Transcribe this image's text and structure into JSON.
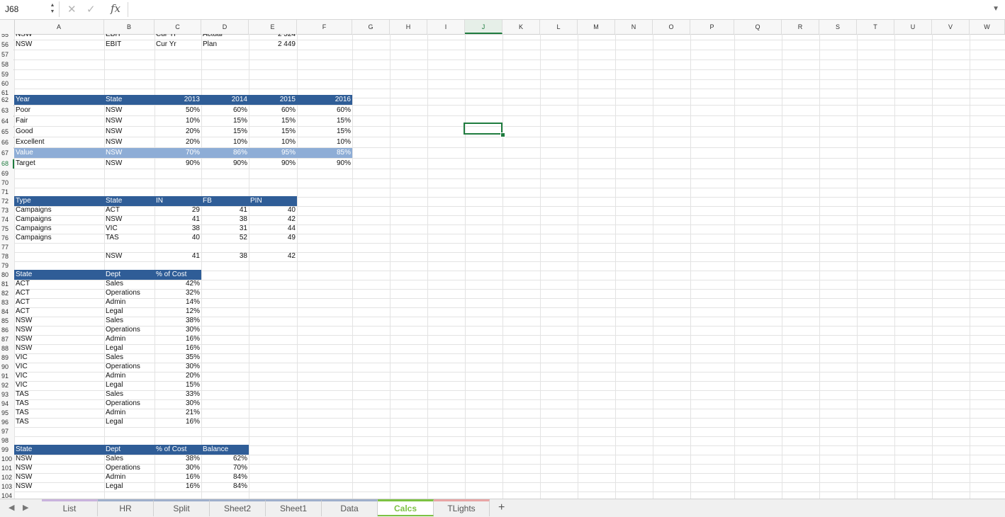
{
  "formula_bar": {
    "name_box": "J68",
    "cancel_icon": "x-icon",
    "confirm_icon": "check-icon",
    "function_label": "fx",
    "formula": ""
  },
  "columns": [
    "A",
    "B",
    "C",
    "D",
    "E",
    "F",
    "G",
    "H",
    "I",
    "J",
    "K",
    "L",
    "M",
    "N",
    "O",
    "P",
    "Q",
    "R",
    "S",
    "T",
    "U",
    "V",
    "W"
  ],
  "selected_column": "J",
  "row_numbers": [
    "55",
    "56",
    "57",
    "58",
    "59",
    "60",
    "61",
    "62",
    "63",
    "64",
    "65",
    "66",
    "67",
    "68",
    "69",
    "70",
    "71",
    "72",
    "73",
    "74",
    "75",
    "76",
    "77",
    "78",
    "79",
    "80",
    "81",
    "82",
    "83",
    "84",
    "85",
    "86",
    "87",
    "88",
    "89",
    "90",
    "91",
    "92",
    "93",
    "94",
    "95",
    "96",
    "97",
    "98",
    "99",
    "100",
    "101",
    "102",
    "103",
    "104"
  ],
  "selected_row": "68",
  "top_rows": {
    "row55": [
      "NSW",
      "EBIT",
      "Cur Yr",
      "Actual",
      "2 524"
    ],
    "row56": [
      "NSW",
      "EBIT",
      "Cur Yr",
      "Plan",
      "2 449"
    ]
  },
  "table1": {
    "headers": [
      "Year",
      "State",
      "2013",
      "2014",
      "2015",
      "2016"
    ],
    "rows": [
      [
        "Poor",
        "NSW",
        "50%",
        "60%",
        "60%",
        "60%"
      ],
      [
        "Fair",
        "NSW",
        "10%",
        "15%",
        "15%",
        "15%"
      ],
      [
        "Good",
        "NSW",
        "20%",
        "15%",
        "15%",
        "15%"
      ],
      [
        "Excellent",
        "NSW",
        "20%",
        "10%",
        "10%",
        "10%"
      ],
      [
        "Value",
        "NSW",
        "70%",
        "86%",
        "95%",
        "85%"
      ],
      [
        "Target",
        "NSW",
        "90%",
        "90%",
        "90%",
        "90%"
      ]
    ]
  },
  "table2": {
    "headers": [
      "Type",
      "State",
      "IN",
      "FB",
      "PIN"
    ],
    "rows": [
      [
        "Campaigns",
        "ACT",
        "29",
        "41",
        "40"
      ],
      [
        "Campaigns",
        "NSW",
        "41",
        "38",
        "42"
      ],
      [
        "Campaigns",
        "VIC",
        "38",
        "31",
        "44"
      ],
      [
        "Campaigns",
        "TAS",
        "40",
        "52",
        "49"
      ]
    ],
    "summary": [
      "NSW",
      "41",
      "38",
      "42"
    ]
  },
  "table3": {
    "headers": [
      "State",
      "Dept",
      "% of Cost"
    ],
    "rows": [
      [
        "ACT",
        "Sales",
        "42%"
      ],
      [
        "ACT",
        "Operations",
        "32%"
      ],
      [
        "ACT",
        "Admin",
        "14%"
      ],
      [
        "ACT",
        "Legal",
        "12%"
      ],
      [
        "NSW",
        "Sales",
        "38%"
      ],
      [
        "NSW",
        "Operations",
        "30%"
      ],
      [
        "NSW",
        "Admin",
        "16%"
      ],
      [
        "NSW",
        "Legal",
        "16%"
      ],
      [
        "VIC",
        "Sales",
        "35%"
      ],
      [
        "VIC",
        "Operations",
        "30%"
      ],
      [
        "VIC",
        "Admin",
        "20%"
      ],
      [
        "VIC",
        "Legal",
        "15%"
      ],
      [
        "TAS",
        "Sales",
        "33%"
      ],
      [
        "TAS",
        "Operations",
        "30%"
      ],
      [
        "TAS",
        "Admin",
        "21%"
      ],
      [
        "TAS",
        "Legal",
        "16%"
      ]
    ]
  },
  "table4": {
    "headers": [
      "State",
      "Dept",
      "% of Cost",
      "Balance"
    ],
    "rows": [
      [
        "NSW",
        "Sales",
        "38%",
        "62%"
      ],
      [
        "NSW",
        "Operations",
        "30%",
        "70%"
      ],
      [
        "NSW",
        "Admin",
        "16%",
        "84%"
      ],
      [
        "NSW",
        "Legal",
        "16%",
        "84%"
      ]
    ]
  },
  "sheet_tabs": [
    {
      "label": "List",
      "color": "#c9b3dd"
    },
    {
      "label": "HR",
      "color": "#9fb0cc"
    },
    {
      "label": "Split",
      "color": "#9fb0cc"
    },
    {
      "label": "Sheet2",
      "color": "#9fb0cc"
    },
    {
      "label": "Sheet1",
      "color": "#9fb0cc"
    },
    {
      "label": "Data",
      "color": "#9fb0cc"
    },
    {
      "label": "Calcs",
      "color": "#7dc243"
    },
    {
      "label": "TLights",
      "color": "#e8a5a5"
    }
  ],
  "active_tab": "Calcs",
  "colors": {
    "header_blue": "#2f5d97",
    "highlight_blue": "#8eadd6",
    "selection_green": "#1f7c3f",
    "active_tab_green": "#7dc243"
  }
}
